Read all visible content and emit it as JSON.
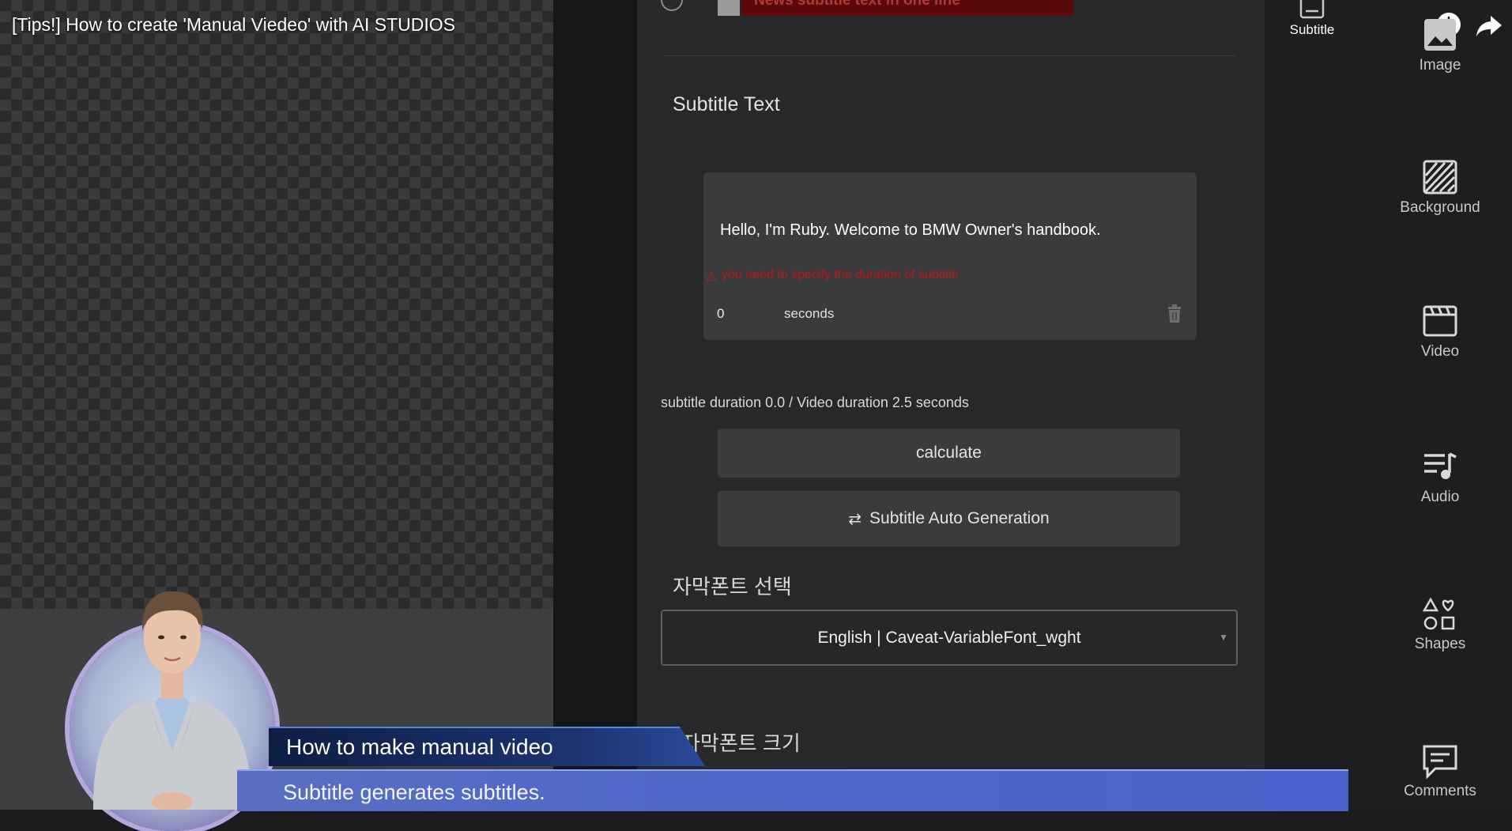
{
  "video": {
    "title": "[Tips!] How to create 'Manual Viedeo' with AI STUDIOS"
  },
  "editor": {
    "top_row_text": "News subtitle text in one line",
    "section_title": "Subtitle Text",
    "subtitle_item": {
      "text": "Hello, I'm Ruby. Welcome to BMW Owner's handbook.",
      "warning": "you need to specify the duration of subtitle",
      "seconds_value": "0",
      "seconds_label": "seconds"
    },
    "duration_info": "subtitle duration 0.0 / Video duration 2.5 seconds",
    "calculate_label": "calculate",
    "auto_generation_label": "Subtitle Auto Generation",
    "font_select_label": "자막폰트 선택",
    "font_select_value": "English | Caveat-VariableFont_wght",
    "font_size_label": "자막폰트 크기"
  },
  "sidebar": {
    "subtitle": "Subtitle",
    "image": "Image",
    "background": "Background",
    "video": "Video",
    "audio": "Audio",
    "shapes": "Shapes",
    "comments": "Comments"
  },
  "overlay": {
    "banner_title": "How to make manual video",
    "banner_caption": "Subtitle generates subtitles."
  },
  "colors": {
    "warning": "#c01818",
    "banner_blue": "#4e66c8",
    "panel_bg": "#272829"
  }
}
